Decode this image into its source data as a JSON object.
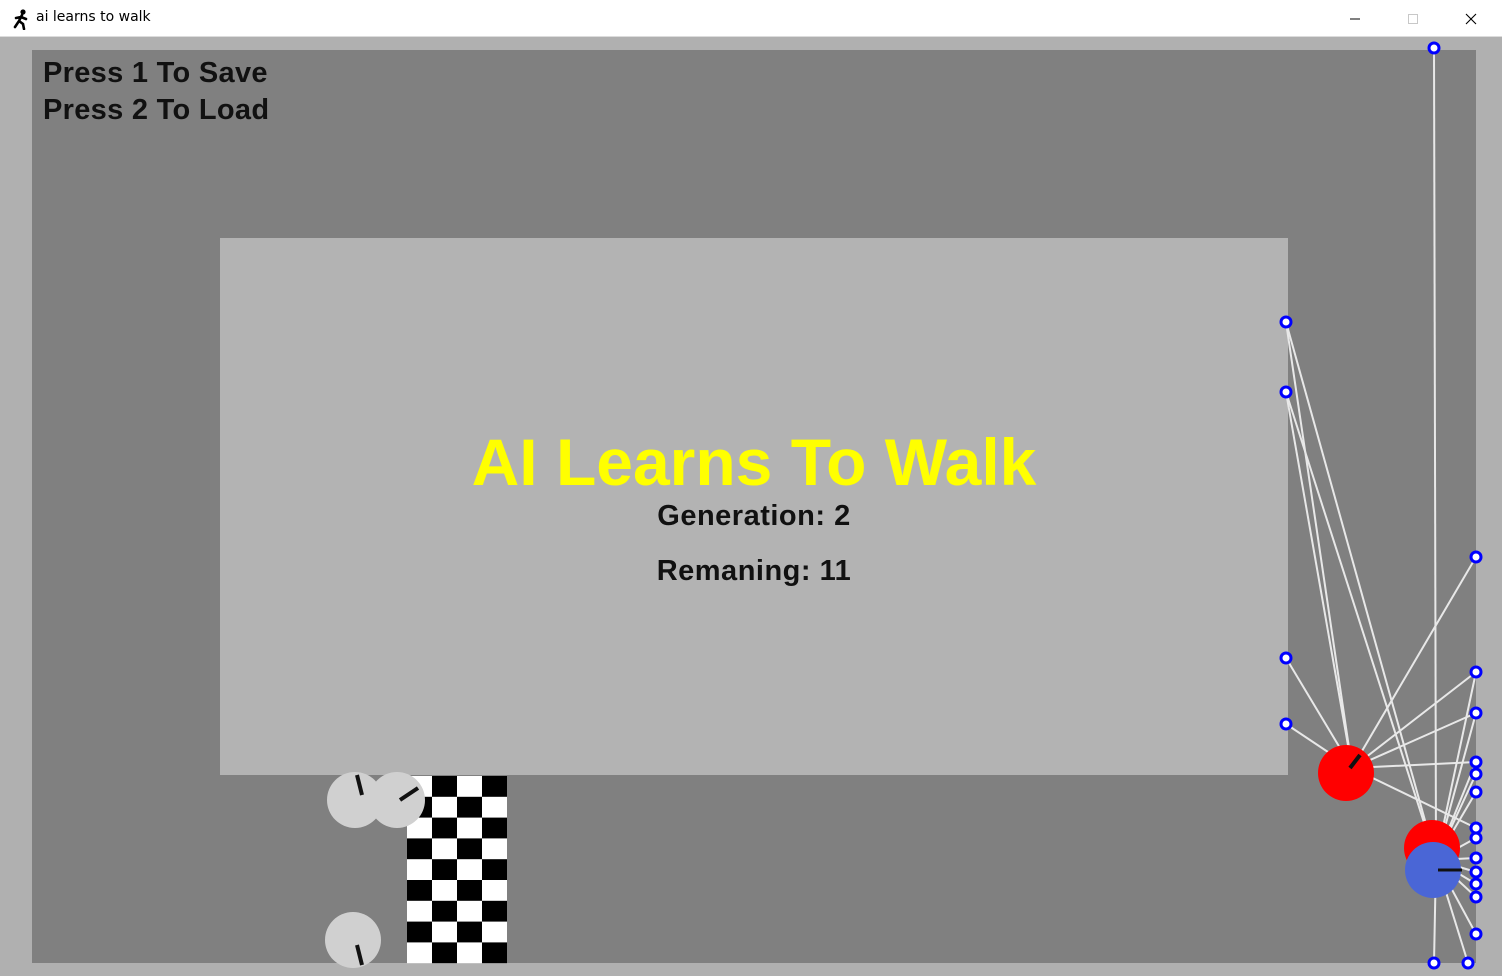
{
  "window": {
    "title": "ai learns to walk",
    "app_icon": "walking-figure-icon",
    "controls": [
      "minimize-icon",
      "maximize-icon",
      "close-icon"
    ]
  },
  "hints": {
    "save": "Press 1 To Save",
    "load": "Press 2 To Load"
  },
  "panel": {
    "title": "AI Learns To Walk",
    "generation_label": "Generation:",
    "generation_value": "2",
    "remaining_label": "Remaning:",
    "remaining_value": "11"
  },
  "colors": {
    "background": "#b0b0b0",
    "field": "#808080",
    "panel": "#b3b3b3",
    "title": "#ffff00",
    "node_outline": "#0000ff",
    "limb_line": "#e8e8e8",
    "walker_red": "#ff0000",
    "walker_blue": "#4a66d6",
    "flag_dark": "#000000",
    "flag_light": "#ffffff",
    "idle_walker": "#d0d0d0"
  },
  "scene": {
    "finish_flag": {
      "rows": 9,
      "cols": 4
    },
    "idle_walkers": 3,
    "walkers": [
      {
        "color": "red"
      },
      {
        "color": "red"
      },
      {
        "color": "blue"
      }
    ]
  }
}
